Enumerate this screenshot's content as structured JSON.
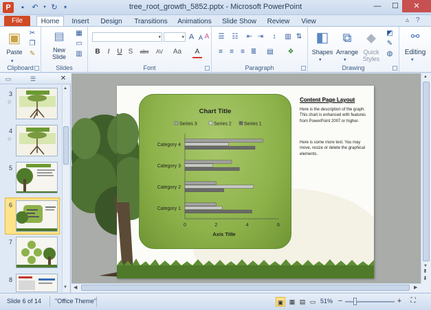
{
  "window": {
    "title": "tree_root_growth_5852.pptx - Microsoft PowerPoint",
    "minimize": "—",
    "maximize": "☐",
    "close": "✕"
  },
  "tabs": [
    {
      "label": "File"
    },
    {
      "label": "Home"
    },
    {
      "label": "Insert"
    },
    {
      "label": "Design"
    },
    {
      "label": "Transitions"
    },
    {
      "label": "Animations"
    },
    {
      "label": "Slide Show"
    },
    {
      "label": "Review"
    },
    {
      "label": "View"
    }
  ],
  "ribbon": {
    "clipboard": {
      "label": "Clipboard",
      "paste": "Paste"
    },
    "slides": {
      "label": "Slides",
      "new_slide_line1": "New",
      "new_slide_line2": "Slide"
    },
    "font": {
      "label": "Font",
      "bold": "B",
      "italic": "I",
      "underline": "U",
      "strike": "S",
      "shadow": "abc",
      "spacing": "AV",
      "case": "Aa",
      "color": "A",
      "grow": "A",
      "shrink": "A",
      "clear": "A"
    },
    "paragraph": {
      "label": "Paragraph"
    },
    "drawing": {
      "label": "Drawing",
      "shapes": "Shapes",
      "arrange": "Arrange",
      "quick_styles_line1": "Quick",
      "quick_styles_line2": "Styles"
    },
    "editing": {
      "label": "Editing"
    }
  },
  "panel": {
    "slides": [
      {
        "num": "3"
      },
      {
        "num": "4"
      },
      {
        "num": "5"
      },
      {
        "num": "6"
      },
      {
        "num": "7"
      },
      {
        "num": "8"
      }
    ]
  },
  "slide": {
    "heading": "Content Page Layout",
    "para1": "Here is the description of the graph.  This chart is enhanced with features from PowerPoint 2007 or higher.",
    "para2": "Here is some more text.  You may move, resize or delete the graphical elements."
  },
  "chart_data": {
    "type": "bar",
    "orientation": "horizontal",
    "title": "Chart Title",
    "xlabel": "Axis Title",
    "ylabel": "",
    "categories": [
      "Category 1",
      "Category 2",
      "Category 3",
      "Category 4"
    ],
    "series": [
      {
        "name": "Series 1",
        "values": [
          4.3,
          2.5,
          3.5,
          4.5
        ],
        "color": "#6b6b6b"
      },
      {
        "name": "Series 2",
        "values": [
          2.4,
          4.4,
          1.8,
          2.8
        ],
        "color": "#c8c8c8"
      },
      {
        "name": "Series 3",
        "values": [
          2.0,
          2.0,
          3.0,
          5.0
        ],
        "color": "#a0a0a0"
      }
    ],
    "legend_order": [
      "Series 3",
      "Series 2",
      "Series 1"
    ],
    "xlim": [
      0,
      6
    ],
    "xticks": [
      "0",
      "2",
      "4",
      "6"
    ],
    "legend": "top",
    "grid": false
  },
  "status": {
    "slide_info": "Slide 6 of 14",
    "theme": "\"Office Theme\"",
    "zoom": "51%"
  },
  "colors": {
    "accent": "#d04a25",
    "ribbon_text": "#1e395b",
    "chart_panel": "#8db24a"
  }
}
